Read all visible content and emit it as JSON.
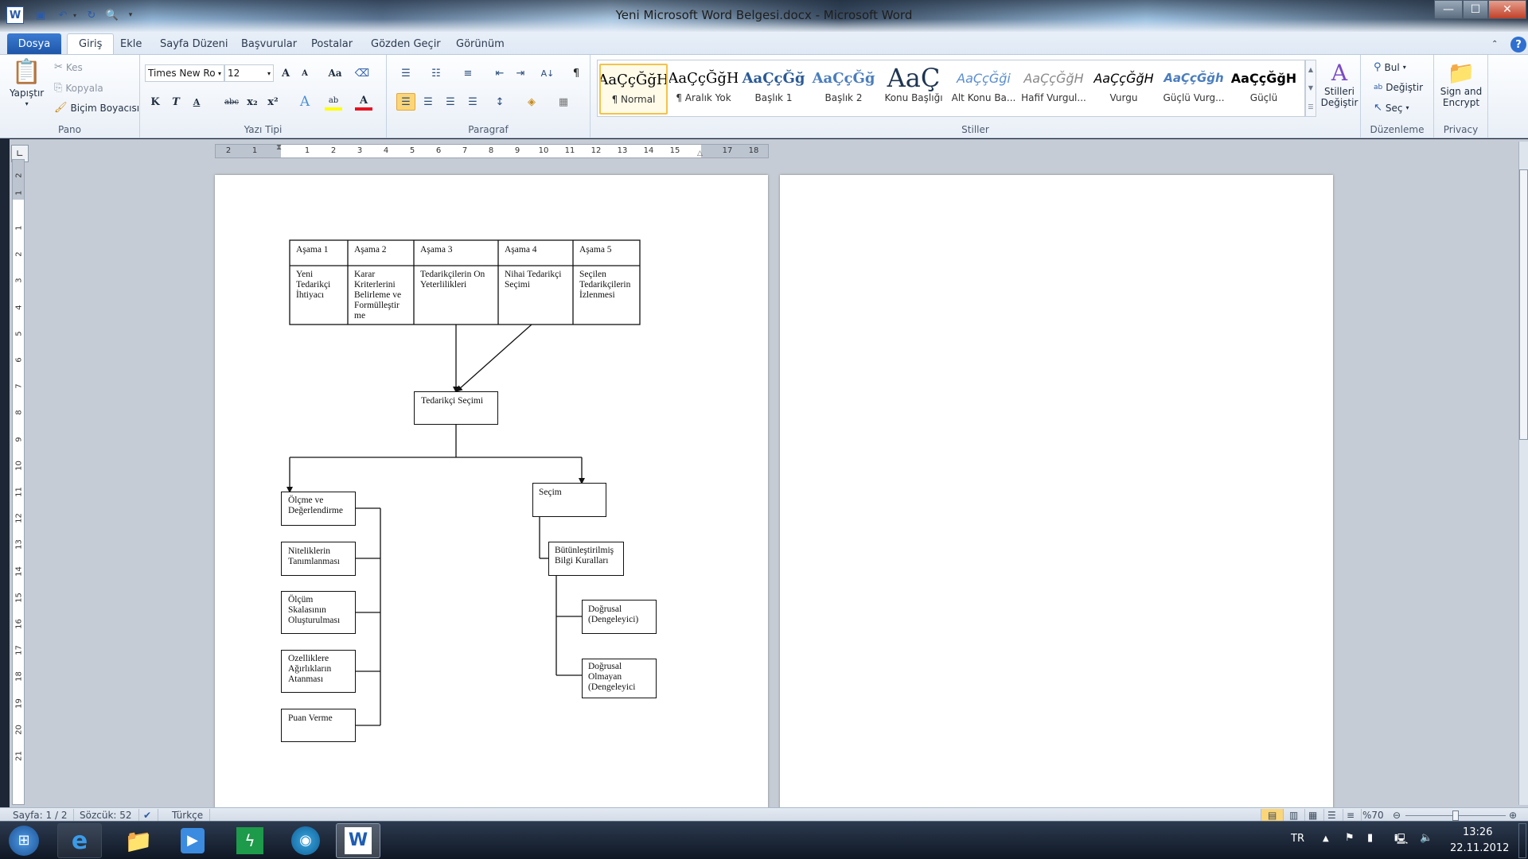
{
  "window": {
    "title": "Yeni Microsoft Word Belgesi.docx - Microsoft Word",
    "app_icon": "W",
    "quick_access": [
      {
        "name": "save-icon",
        "glyph": "💾"
      },
      {
        "name": "undo-icon",
        "glyph": "↶"
      },
      {
        "name": "redo-icon",
        "glyph": "↻"
      },
      {
        "name": "print-preview-icon",
        "glyph": "🔍"
      }
    ],
    "controls": {
      "minimize": "—",
      "maximize": "☐",
      "close": "✕"
    }
  },
  "tabs": [
    {
      "label": "Dosya",
      "active": false
    },
    {
      "label": "Giriş",
      "active": true
    },
    {
      "label": "Ekle"
    },
    {
      "label": "Sayfa Düzeni"
    },
    {
      "label": "Başvurular"
    },
    {
      "label": "Postalar"
    },
    {
      "label": "Gözden Geçir"
    },
    {
      "label": "Görünüm"
    }
  ],
  "ribbon": {
    "clipboard": {
      "label": "Pano",
      "paste": "Yapıştır",
      "cut": "Kes",
      "copy": "Kopyala",
      "format_painter": "Biçim Boyacısı"
    },
    "font": {
      "label": "Yazı Tipi",
      "font_name": "Times New Ro",
      "font_size": "12",
      "bold": "K",
      "italic": "T",
      "underline": "A",
      "strike": "abc",
      "subscript": "x₂",
      "superscript": "x²",
      "grow": "A",
      "shrink": "A",
      "case": "Aa",
      "highlight_color": "#ffff00",
      "font_color": "#e81123"
    },
    "paragraph": {
      "label": "Paragraf"
    },
    "styles": {
      "label": "Stiller",
      "items": [
        {
          "preview": "AaÇçĞğH",
          "name": "¶ Normal",
          "selected": true
        },
        {
          "preview": "AaÇçĞğH",
          "name": "¶ Aralık Yok"
        },
        {
          "preview": "AaÇçĞğ",
          "name": "Başlık 1"
        },
        {
          "preview": "AaÇçĞğ",
          "name": "Başlık 2"
        },
        {
          "preview": "AaÇ",
          "name": "Konu Başlığı"
        },
        {
          "preview": "AaÇçĞği",
          "name": "Alt Konu Ba..."
        },
        {
          "preview": "AaÇçĞğH",
          "name": "Hafif Vurgul..."
        },
        {
          "preview": "AaÇçĞğH",
          "name": "Vurgu"
        },
        {
          "preview": "AaÇçĞğh",
          "name": "Güçlü Vurg..."
        },
        {
          "preview": "AaÇçĞğH",
          "name": "Güçlü"
        }
      ],
      "change_styles": "Stilleri Değiştir"
    },
    "editing": {
      "label": "Düzenleme",
      "find": "Bul",
      "replace": "Değiştir",
      "select": "Seç"
    },
    "privacy": {
      "label": "Privacy",
      "sign": "Sign and Encrypt"
    }
  },
  "ruler": {
    "h_numbers": [
      "2",
      "1",
      "1",
      "2",
      "3",
      "4",
      "5",
      "6",
      "7",
      "8",
      "9",
      "10",
      "11",
      "12",
      "13",
      "14",
      "15",
      "17",
      "18"
    ],
    "v_numbers": [
      "2",
      "1",
      "1",
      "2",
      "3",
      "4",
      "5",
      "6",
      "7",
      "8",
      "9",
      "10",
      "11",
      "12",
      "13",
      "14",
      "15",
      "16",
      "17",
      "18",
      "19",
      "20",
      "21"
    ]
  },
  "document": {
    "table": {
      "headers": [
        "Aşama 1",
        "Aşama 2",
        "Aşama 3",
        "Aşama 4",
        "Aşama 5"
      ],
      "cells": [
        "Yeni Tedarikçi İhtiyacı",
        "Karar Kriterlerini Belirleme ve Formülleştir me",
        "Tedarikçilerin On Yeterlilikleri",
        "Nihai Tedarikçi Seçimi",
        "Seçilen Tedarikçilerin İzlenmesi"
      ]
    },
    "diagram": {
      "root": "Tedarikçi Seçimi",
      "left_branch": "Ölçme ve Değerlendirme",
      "left_children": [
        "Niteliklerin Tanımlanması",
        "Ölçüm Skalasının Oluşturulması",
        "Ozelliklere Ağırlıkların Atanması",
        "Puan Verme"
      ],
      "right_branch": "Seçim",
      "right_child": "Bütünleştirilmiş Bilgi Kuralları",
      "right_grandchildren": [
        "Doğrusal (Dengeleyici)",
        "Doğrusal Olmayan (Dengeleyici"
      ]
    }
  },
  "status": {
    "page": "Sayfa: 1 / 2",
    "words": "Sözcük: 52",
    "language": "Türkçe",
    "zoom": "%70",
    "zoom_fraction": 0.5
  },
  "taskbar": {
    "apps": [
      {
        "name": "start-button"
      },
      {
        "name": "internet-explorer"
      },
      {
        "name": "file-explorer"
      },
      {
        "name": "media-player"
      },
      {
        "name": "green-app"
      },
      {
        "name": "network-app"
      },
      {
        "name": "word",
        "active": true
      }
    ],
    "lang": "TR",
    "time": "13:26",
    "date": "22.11.2012"
  }
}
